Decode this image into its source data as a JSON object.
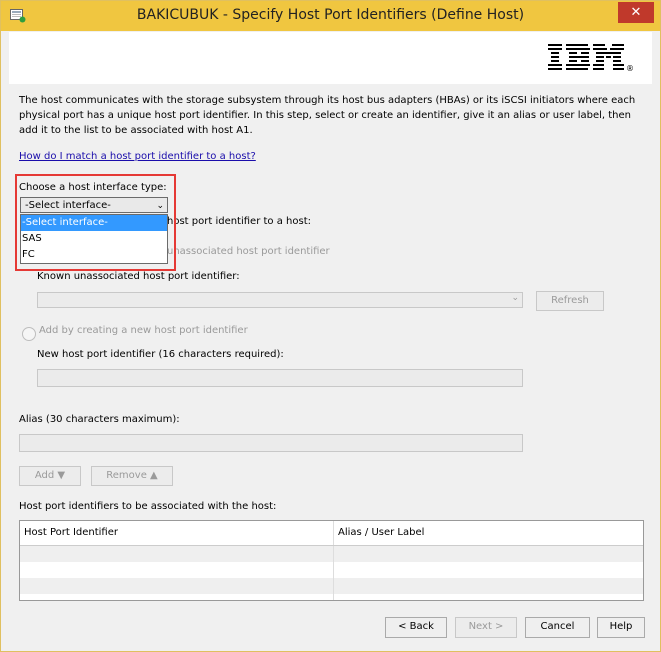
{
  "window": {
    "title": "BAKICUBUK - Specify Host Port Identifiers (Define Host)",
    "close_symbol": "✕"
  },
  "branding": {
    "logo_text": "IBM",
    "logo_mark": "®"
  },
  "intro": {
    "text": "The host communicates with the storage subsystem through its host bus adapters (HBAs) or its iSCSI initiators where each physical port has a unique host port identifier. In this step, select or create an identifier, give it an alias or user label, then add it to the list to be associated with host A1."
  },
  "help_link": "How do I match a host port identifier to a host?",
  "interface": {
    "label": "Choose a host interface type:",
    "selected": "-Select interface-",
    "options": [
      "-Select interface-",
      "SAS",
      "FC"
    ]
  },
  "partially_hidden": {
    "method_label_fragment": "host port identifier to a host:",
    "option_known_fragment": "unassociated host port identifier"
  },
  "known": {
    "label": "Known unassociated host port identifier:",
    "refresh": "Refresh"
  },
  "new_id": {
    "radio_label": "Add by creating a new host port identifier",
    "label": "New host port identifier (16 characters required):"
  },
  "alias": {
    "label": "Alias (30 characters maximum):"
  },
  "actions": {
    "add": "Add ▼",
    "remove": "Remove ▲"
  },
  "list": {
    "label": "Host port identifiers to be associated with the host:",
    "columns": [
      "Host Port Identifier",
      "Alias / User Label"
    ]
  },
  "footer": {
    "back": "< Back",
    "next": "Next >",
    "cancel": "Cancel",
    "help": "Help"
  }
}
